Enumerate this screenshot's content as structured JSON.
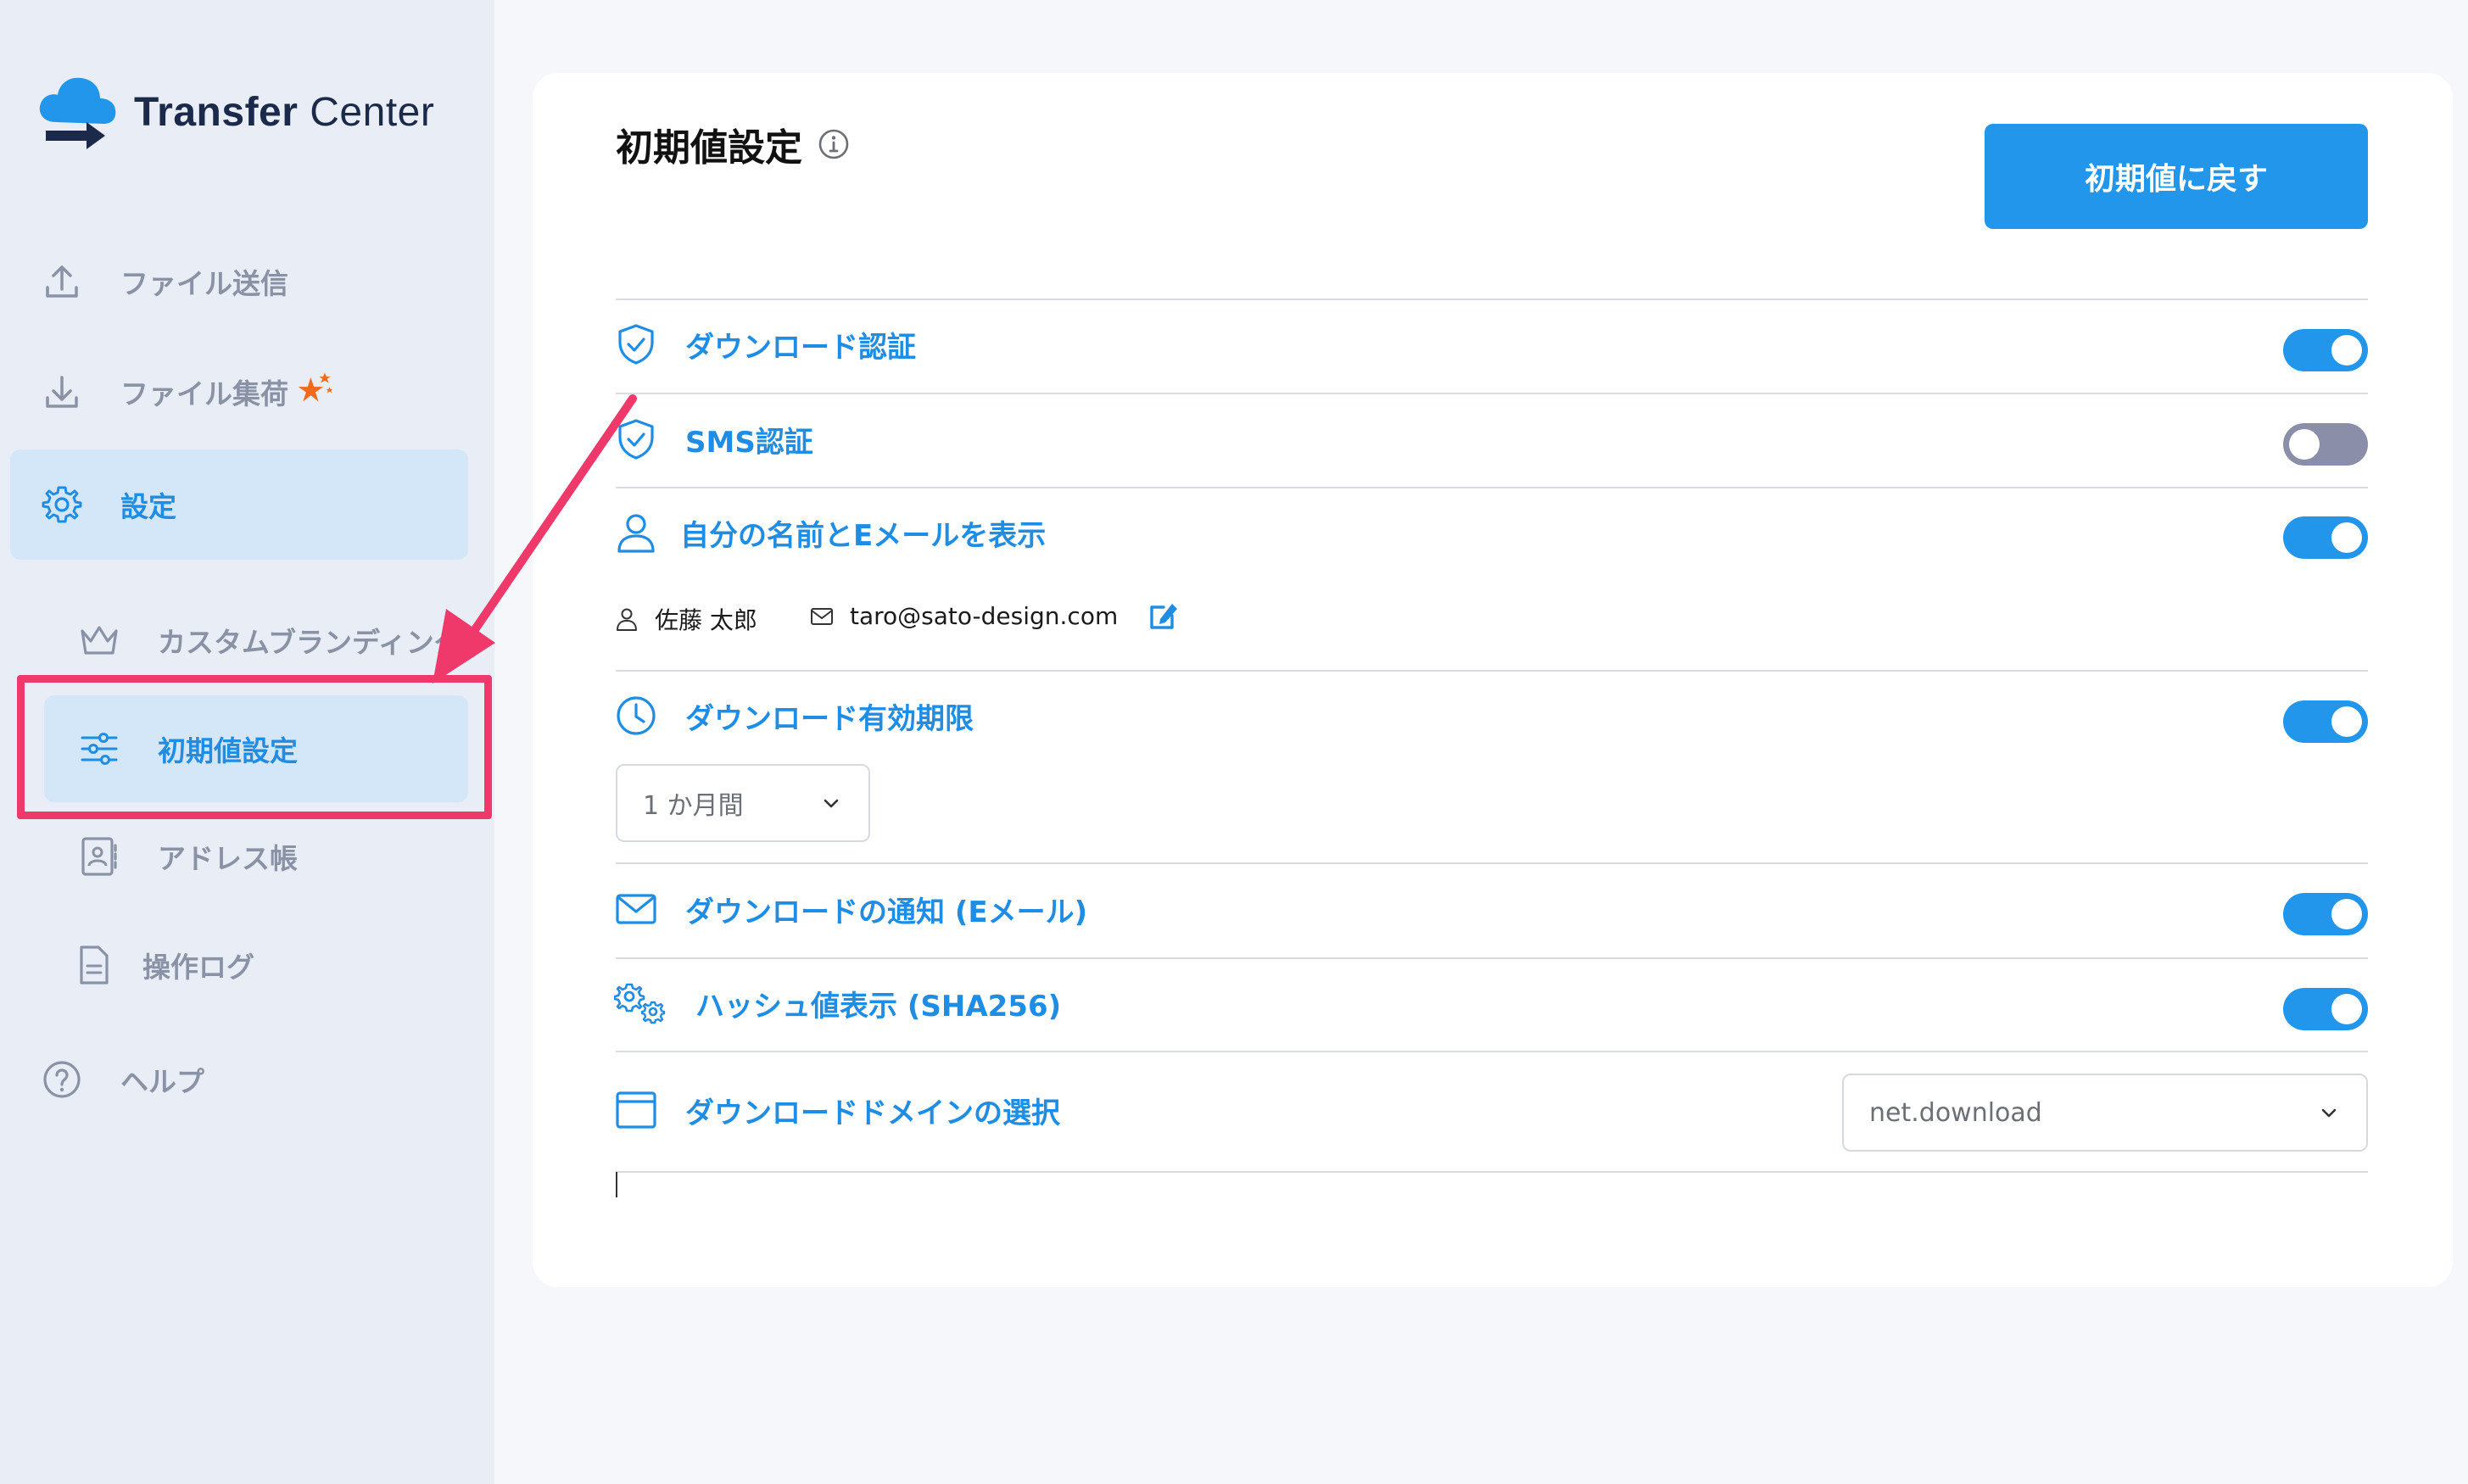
{
  "app": {
    "name_bold": "Transfer",
    "name_light": " Center"
  },
  "sidebar": {
    "items": [
      {
        "label": "ファイル送信",
        "icon": "upload-icon"
      },
      {
        "label": "ファイル集荷",
        "icon": "download-icon",
        "badge_icon": "star-icon"
      },
      {
        "label": "設定",
        "icon": "gear-icon",
        "active": true
      },
      {
        "label": "カスタムブランディング",
        "icon": "crown-icon"
      },
      {
        "label": "初期値設定",
        "icon": "sliders-icon",
        "active": true
      },
      {
        "label": "アドレス帳",
        "icon": "address-book-icon"
      },
      {
        "label": "操作ログ",
        "icon": "document-icon"
      },
      {
        "label": "ヘルプ",
        "icon": "help-icon"
      }
    ]
  },
  "main": {
    "title": "初期値設定",
    "reset_button": "初期値に戻す",
    "settings": [
      {
        "label": "ダウンロード認証",
        "icon": "shield-check-icon",
        "enabled": true
      },
      {
        "label": "SMS認証",
        "icon": "shield-check-icon",
        "enabled": false
      },
      {
        "label": "自分の名前とEメールを表示",
        "icon": "user-icon",
        "enabled": true
      },
      {
        "label": "ダウンロード有効期限",
        "icon": "clock-icon",
        "enabled": true
      },
      {
        "label": "ダウンロードの通知 (Eメール)",
        "icon": "mail-icon",
        "enabled": true
      },
      {
        "label": "ハッシュ値表示 (SHA256)",
        "icon": "gears-icon",
        "enabled": true
      },
      {
        "label": "ダウンロードドメインの選択",
        "icon": "browser-window-icon"
      }
    ],
    "profile": {
      "name": "佐藤 太郎",
      "email": "taro@sato-design.com"
    },
    "expiry_select": {
      "value": "1 か月間"
    },
    "domain_select": {
      "value": "net.download"
    }
  },
  "colors": {
    "accent": "#2196ea",
    "highlight": "#f0396b",
    "sidebar_bg": "#e9eef6",
    "active_bg": "#d3e7f8",
    "toggle_off": "#8a8ea8"
  }
}
